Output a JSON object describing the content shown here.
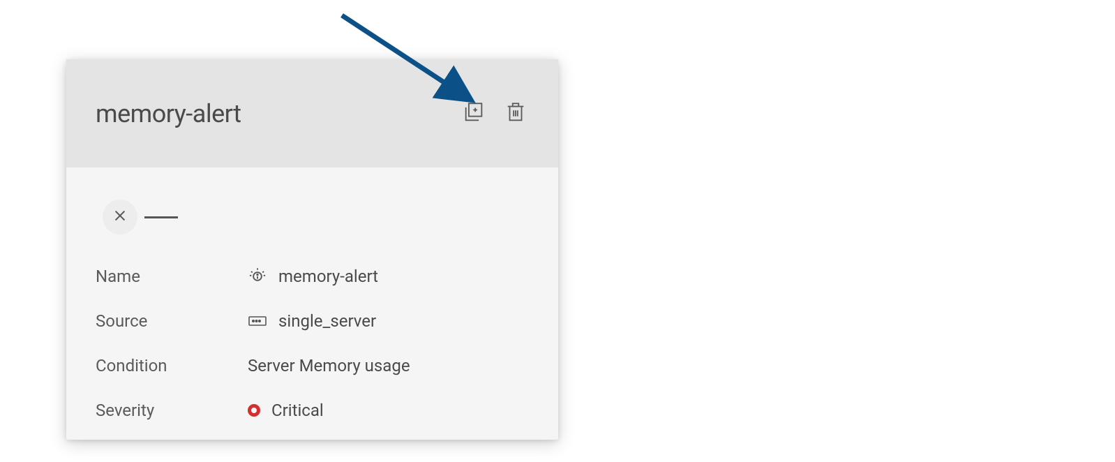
{
  "card": {
    "title": "memory-alert",
    "details": {
      "name": {
        "label": "Name",
        "value": "memory-alert"
      },
      "source": {
        "label": "Source",
        "value": "single_server"
      },
      "condition": {
        "label": "Condition",
        "value": "Server Memory usage"
      },
      "severity": {
        "label": "Severity",
        "value": "Critical"
      }
    }
  },
  "colors": {
    "arrow": "#0b5087",
    "severity": "#d32f2f"
  }
}
